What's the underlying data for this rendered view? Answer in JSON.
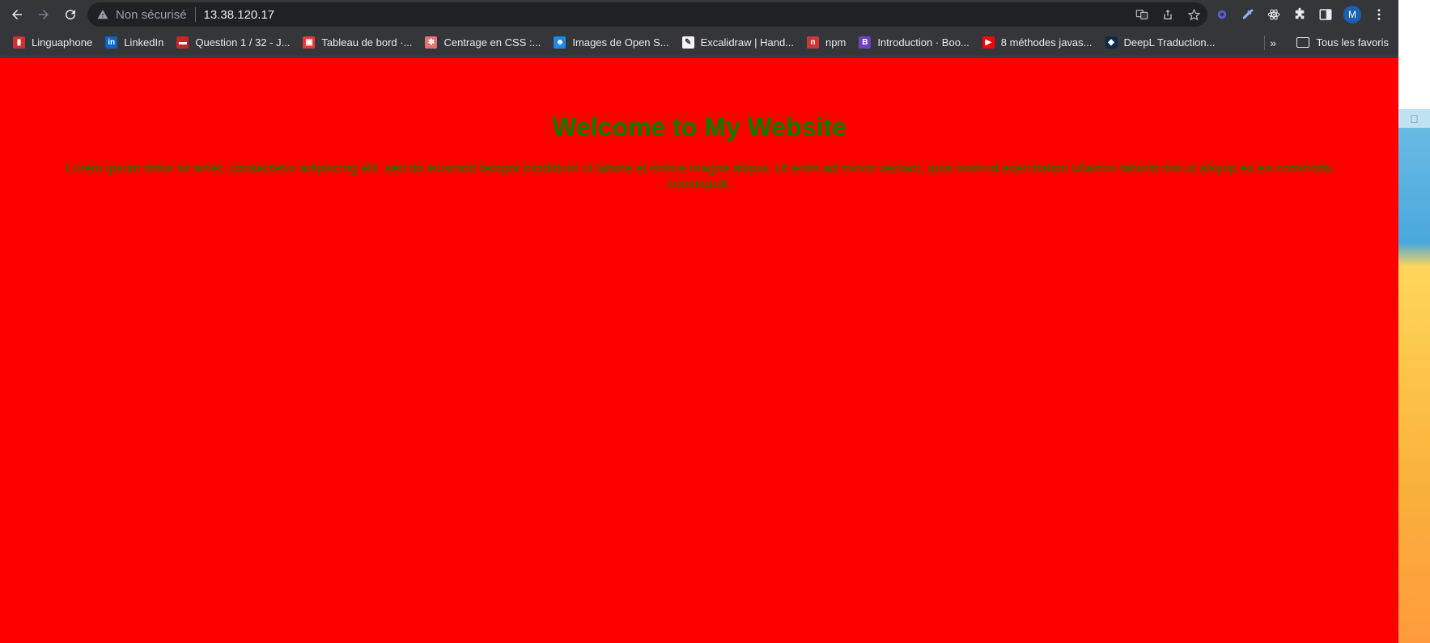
{
  "browser": {
    "security_label": "Non sécurisé",
    "url": "13.38.120.17",
    "profile_initial": "M"
  },
  "bookmarks": {
    "items": [
      {
        "label": "Linguaphone",
        "icon": "linguaphone-icon",
        "color": "#d32f2f"
      },
      {
        "label": "LinkedIn",
        "icon": "linkedin-icon",
        "color": "#0a66c2"
      },
      {
        "label": "Question 1 / 32 - J...",
        "icon": "bus-icon",
        "color": "#c62828"
      },
      {
        "label": "Tableau de bord ·...",
        "icon": "dashboard-icon",
        "color": "#e53935"
      },
      {
        "label": "Centrage en CSS :...",
        "icon": "asterisk-icon",
        "color": "#e57373"
      },
      {
        "label": "Images de Open S...",
        "icon": "robot-icon",
        "color": "#1e88e5"
      },
      {
        "label": "Excalidraw | Hand...",
        "icon": "excalidraw-icon",
        "color": "#f5f5f5"
      },
      {
        "label": "npm",
        "icon": "npm-icon",
        "color": "#cb3837"
      },
      {
        "label": "Introduction · Boo...",
        "icon": "bootstrap-icon",
        "color": "#6f42c1"
      },
      {
        "label": "8 méthodes javas...",
        "icon": "youtube-icon",
        "color": "#ff0000"
      },
      {
        "label": "DeepL Traduction...",
        "icon": "deepl-icon",
        "color": "#0f2b46"
      }
    ],
    "more_label": "»",
    "all_label": "Tous les favoris"
  },
  "page": {
    "title": "Welcome to My Website",
    "text": "Lorem ipsum dolor sit amet, consectetur adipiscing elit, sed do eiusmod tempor incididunt ut labore et dolore magna aliqua. Ut enim ad minim veniam, quis nostrud exercitation ullamco laboris nisi ut aliquip ex ea commodo consequat.",
    "background_color": "#ff0000",
    "text_color": "#008000"
  }
}
